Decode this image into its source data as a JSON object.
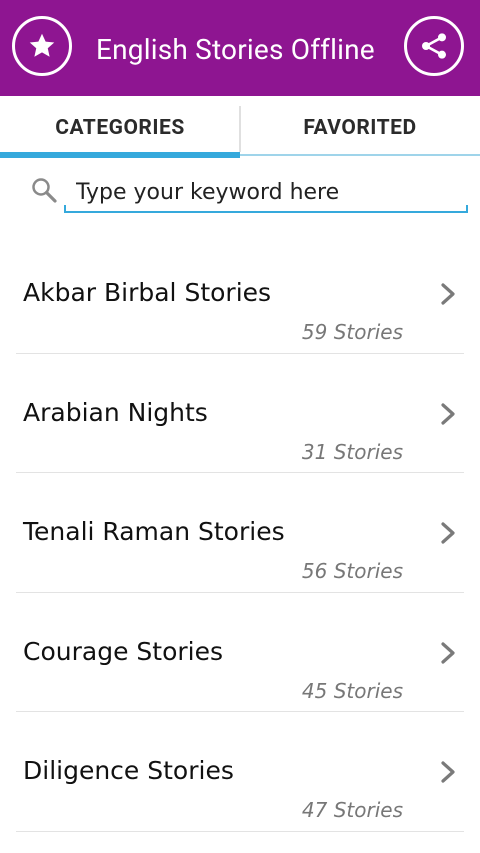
{
  "appbar": {
    "title": "English Stories Offline",
    "left_icon": "star-icon",
    "right_icon": "share-icon",
    "color": "#8e1591"
  },
  "tabs": [
    {
      "label": "CATEGORIES",
      "active": true
    },
    {
      "label": "FAVORITED",
      "active": false
    }
  ],
  "accent_color": "#35a9dc",
  "search": {
    "placeholder": "Type your keyword here",
    "icon": "search-icon"
  },
  "categories": [
    {
      "title": "Akbar Birbal Stories",
      "count": "59 Stories"
    },
    {
      "title": "Arabian Nights",
      "count": "31 Stories"
    },
    {
      "title": "Tenali Raman Stories",
      "count": "56 Stories"
    },
    {
      "title": "Courage Stories",
      "count": "45 Stories"
    },
    {
      "title": "Diligence Stories",
      "count": "47 Stories"
    }
  ]
}
